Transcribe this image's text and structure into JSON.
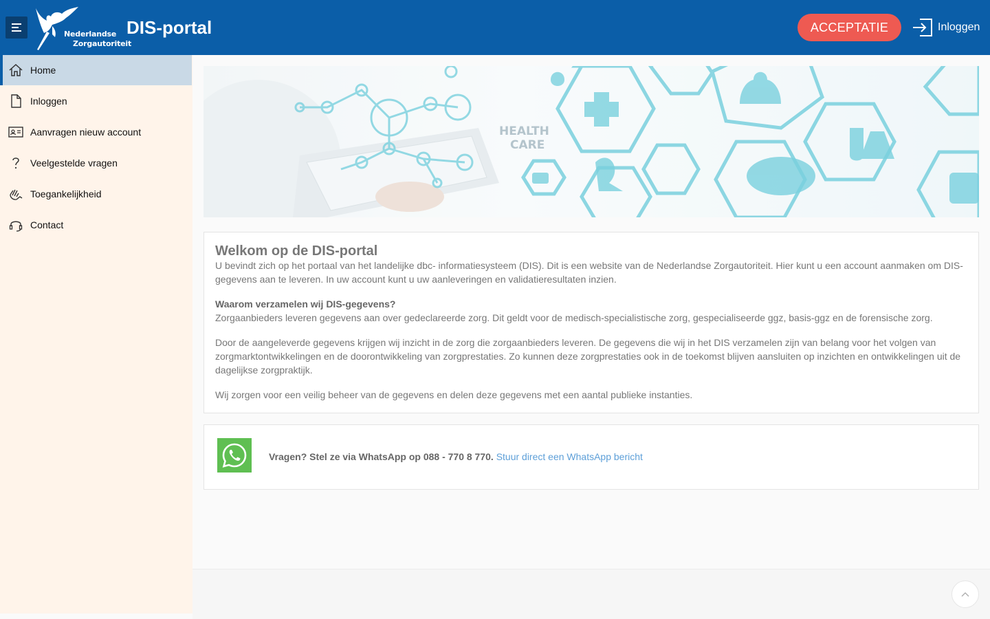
{
  "header": {
    "menu_icon": "hamburger-icon",
    "logo_line1": "Nederlandse",
    "logo_line2": "Zorgautoriteit",
    "app_title": "DIS-portal",
    "environment_badge": "ACCEPTATIE",
    "login_label": "Inloggen",
    "login_icon": "login-icon",
    "colors": {
      "header_bg": "#0b5ea8",
      "badge_bg": "#ee5a52"
    }
  },
  "sidebar": {
    "items": [
      {
        "label": "Home",
        "icon": "home-icon",
        "active": true
      },
      {
        "label": "Inloggen",
        "icon": "document-icon",
        "active": false
      },
      {
        "label": "Aanvragen nieuw account",
        "icon": "id-card-icon",
        "active": false
      },
      {
        "label": "Veelgestelde vragen",
        "icon": "question-icon",
        "active": false
      },
      {
        "label": "Toegankelijkheid",
        "icon": "accessibility-hand-icon",
        "active": false
      },
      {
        "label": "Contact",
        "icon": "headset-icon",
        "active": false
      }
    ]
  },
  "hero": {
    "text1": "HEALTH",
    "text2": "CARE"
  },
  "welcome": {
    "title": "Welkom op de DIS-portal",
    "intro": "U bevindt zich op het portaal van het landelijke dbc- informatiesysteem (DIS). Dit is een website van de Nederlandse Zorgautoriteit. Hier kunt u een account aanmaken om DIS-gegevens aan te leveren. In uw account kunt u uw aanleveringen en validatieresultaten inzien.",
    "why_heading": "Waarom verzamelen wij DIS-gegevens?",
    "why_text": "Zorgaanbieders leveren gegevens aan over gedeclareerde zorg. Dit geldt voor de medisch-specialistische zorg, gespecialiseerde ggz, basis-ggz en de forensische zorg.",
    "insight_text": "Door de aangeleverde gegevens krijgen wij inzicht in de zorg die zorgaanbieders leveren. De gegevens die wij in het DIS verzamelen zijn van belang voor het volgen van zorgmarktontwikkelingen en de doorontwikkeling van zorgprestaties. Zo kunnen deze zorgprestaties ook in de toekomst blijven aansluiten op inzichten en ontwikkelingen uit de dagelijkse zorgpraktijk.",
    "security_text": "Wij zorgen voor een veilig beheer van de gegevens en delen deze gegevens met een aantal publieke instanties."
  },
  "whatsapp": {
    "icon": "whatsapp-icon",
    "question": "Vragen? Stel ze via WhatsApp op 088 - 770 8 770.",
    "link_label": "Stuur direct een WhatsApp bericht"
  },
  "footer": {
    "scroll_top_icon": "chevron-up-icon"
  }
}
